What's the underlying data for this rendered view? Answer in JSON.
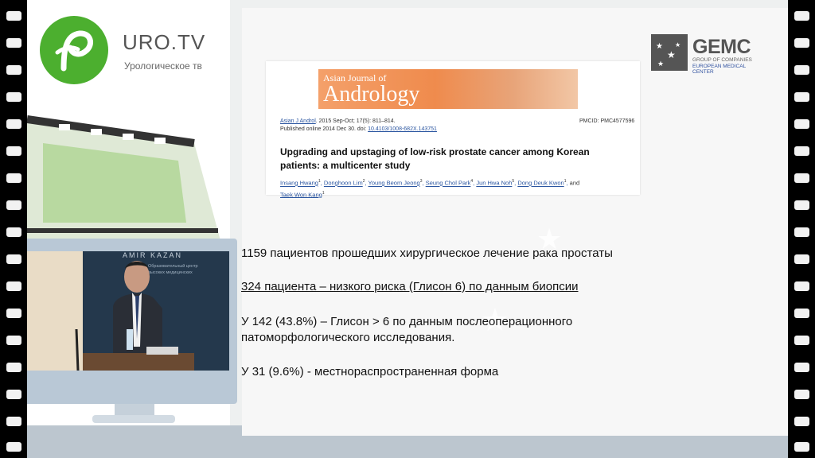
{
  "brand": {
    "title": "URO.TV",
    "subtitle": "Урологическое тв"
  },
  "video": {
    "backdrop_text": "AMIR   KAZAN",
    "backdrop_line1": "Образовательный центр",
    "backdrop_line2": "высоких медицинских"
  },
  "sponsor": {
    "name": "GEMC",
    "line1": "GROUP OF COMPANIES",
    "line2": "EUROPEAN MEDICAL CENTER"
  },
  "article": {
    "journal_small": "Asian Journal of",
    "journal_big": "Andrology",
    "citation_link": "Asian J Androl",
    "citation_rest": ". 2015 Sep-Oct; 17(5): 811–814.",
    "pmcid": "PMCID: PMC4577596",
    "published_prefix": "Published online 2014 Dec 30. doi: ",
    "doi": "10.4103/1008-682X.143751",
    "title": "Upgrading and upstaging of low-risk prostate cancer among Korean patients: a multicenter study",
    "authors": [
      {
        "name": "Insang Hwang",
        "sup": "1"
      },
      {
        "name": "Donghoon Lim",
        "sup": "2"
      },
      {
        "name": "Young Beom Jeong",
        "sup": "3"
      },
      {
        "name": "Seung Chol Park",
        "sup": "4"
      },
      {
        "name": "Jun Hwa Noh",
        "sup": "5"
      },
      {
        "name": "Dong Deuk Kwon",
        "sup": "1"
      },
      {
        "name": "Taek Won Kang",
        "sup": "1"
      }
    ],
    "and_word": "and"
  },
  "slide": {
    "line1": "1159 пациентов прошедших хирургическое лечение рака простаты",
    "line2": "324 пациента – низкого риска (Глисон 6) по данным биопсии",
    "line3a": "У  142 (43.8%) – Глисон > 6 по данным послеоперационного",
    "line3b": "патоморфологического исследования.",
    "line4": "У 31 (9.6%)  - местнораспространенная форма"
  },
  "colors": {
    "brand_green": "#4caf2f",
    "banner_orange": "#ef8b4d",
    "link_blue": "#2a55a0"
  }
}
